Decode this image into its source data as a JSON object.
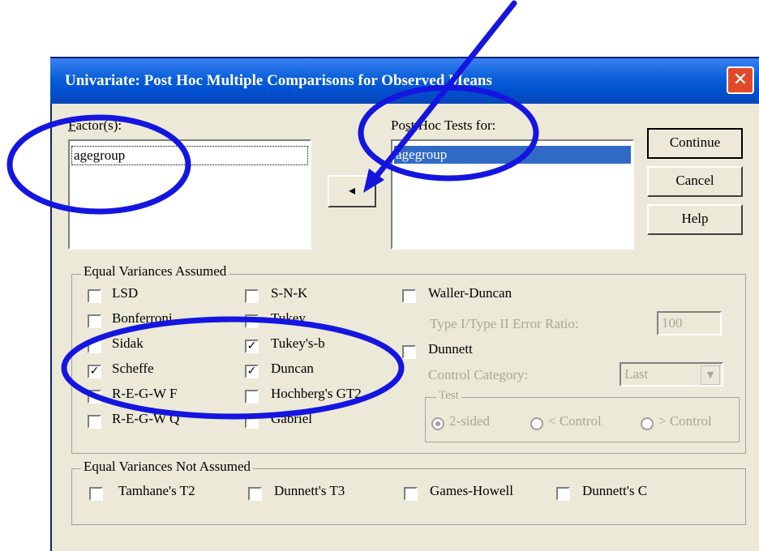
{
  "window": {
    "title": "Univariate: Post Hoc Multiple Comparisons for Observed Means",
    "close_glyph": "✕"
  },
  "factors": {
    "label": "Factor(s):",
    "items": [
      "agegroup"
    ]
  },
  "move_button": {
    "glyph": "◂"
  },
  "posthoc": {
    "label": "Post Hoc Tests for:",
    "items": [
      "agegroup"
    ]
  },
  "buttons": {
    "continue": "Continue",
    "cancel": "Cancel",
    "help": "Help"
  },
  "equal_assumed": {
    "title": "Equal Variances Assumed",
    "col1": [
      {
        "label": "LSD",
        "checked": false
      },
      {
        "label": "Bonferroni",
        "checked": false
      },
      {
        "label": "Sidak",
        "checked": false
      },
      {
        "label": "Scheffe",
        "checked": true
      },
      {
        "label": "R-E-G-W F",
        "checked": false
      },
      {
        "label": "R-E-G-W Q",
        "checked": false
      }
    ],
    "col2": [
      {
        "label": "S-N-K",
        "checked": false
      },
      {
        "label": "Tukey",
        "checked": false
      },
      {
        "label": "Tukey's-b",
        "checked": true
      },
      {
        "label": "Duncan",
        "checked": true
      },
      {
        "label": "Hochberg's GT2",
        "checked": false
      },
      {
        "label": "Gabriel",
        "checked": false
      }
    ],
    "waller": {
      "label": "Waller-Duncan",
      "checked": false
    },
    "ratio_label": "Type I/Type II Error Ratio:",
    "ratio_value": "100",
    "dunnett": {
      "label": "Dunnett",
      "checked": false
    },
    "control_label": "Control Category:",
    "control_value": "Last",
    "dropdown_glyph": "▼",
    "test": {
      "title": "Test",
      "options": [
        {
          "label": "2-sided",
          "selected": true
        },
        {
          "label": "< Control",
          "selected": false
        },
        {
          "label": "> Control",
          "selected": false
        }
      ]
    }
  },
  "not_assumed": {
    "title": "Equal Variances Not Assumed",
    "items": [
      {
        "label": "Tamhane's T2",
        "checked": false
      },
      {
        "label": "Dunnett's T3",
        "checked": false
      },
      {
        "label": "Games-Howell",
        "checked": false
      },
      {
        "label": "Dunnett's C",
        "checked": false
      }
    ]
  },
  "colors": {
    "title_bar": "#0a5fd8",
    "dialog_bg": "#ece9d8",
    "annotation": "#1515e0",
    "selection": "#316ac5"
  }
}
